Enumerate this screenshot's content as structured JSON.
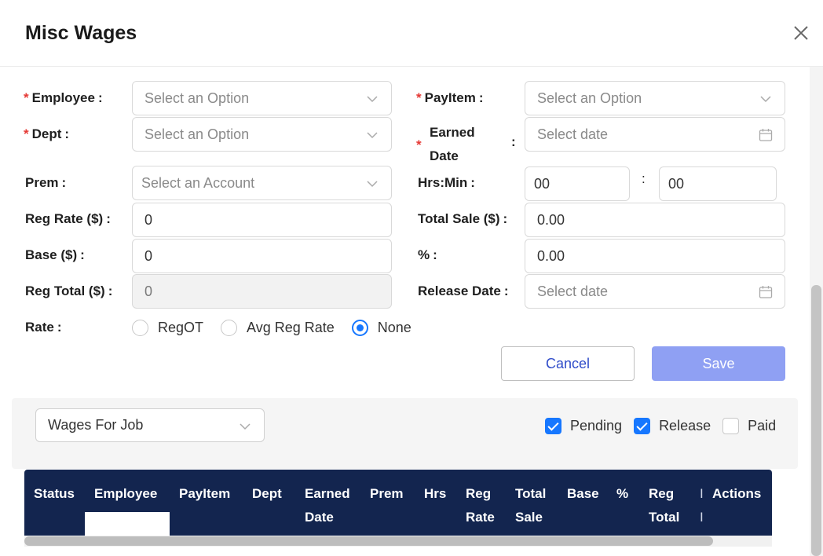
{
  "dialog": {
    "title": "Misc Wages"
  },
  "form": {
    "employee": {
      "label": "Employee",
      "required": true,
      "placeholder": "Select an Option"
    },
    "payitem": {
      "label": "PayItem",
      "required": true,
      "placeholder": "Select an Option"
    },
    "dept": {
      "label": "Dept",
      "required": true,
      "placeholder": "Select an Option"
    },
    "earned_date": {
      "label_line1": "Earned",
      "label_line2": "Date",
      "required": true,
      "placeholder": "Select date"
    },
    "prem": {
      "label": "Prem",
      "placeholder": "Select an Account"
    },
    "hrs_min": {
      "label": "Hrs:Min",
      "hours": "00",
      "separator": ":",
      "minutes": "00"
    },
    "reg_rate": {
      "label": "Reg Rate ($)",
      "value": "0"
    },
    "total_sale": {
      "label": "Total Sale ($)",
      "value": "0.00"
    },
    "base": {
      "label": "Base ($)",
      "value": "0"
    },
    "percent": {
      "label": "%",
      "value": "0.00"
    },
    "reg_total": {
      "label": "Reg Total ($)",
      "value": "0"
    },
    "release_date": {
      "label": "Release Date",
      "placeholder": "Select date"
    },
    "rate": {
      "label": "Rate",
      "options": [
        "RegOT",
        "Avg Reg Rate",
        "None"
      ],
      "selected": "None"
    },
    "colon": ":",
    "required_mark": "*",
    "buttons": {
      "cancel": "Cancel",
      "save": "Save"
    }
  },
  "filters": {
    "wages_select": "Wages For Job",
    "checkboxes": [
      {
        "label": "Pending",
        "checked": true
      },
      {
        "label": "Release",
        "checked": true
      },
      {
        "label": "Paid",
        "checked": false
      }
    ]
  },
  "table": {
    "columns": [
      {
        "line1": "Status",
        "line2": ""
      },
      {
        "line1": "Employee",
        "line2": ""
      },
      {
        "line1": "PayItem",
        "line2": ""
      },
      {
        "line1": "Dept",
        "line2": ""
      },
      {
        "line1": "Earned",
        "line2": "Date"
      },
      {
        "line1": "Prem",
        "line2": ""
      },
      {
        "line1": "Hrs",
        "line2": ""
      },
      {
        "line1": "Reg",
        "line2": "Rate"
      },
      {
        "line1": "Total",
        "line2": "Sale"
      },
      {
        "line1": "Base",
        "line2": ""
      },
      {
        "line1": "%",
        "line2": ""
      },
      {
        "line1": "Reg",
        "line2": "Total"
      },
      {
        "line1": "I",
        "line2": "I"
      },
      {
        "line1": "Actions",
        "line2": ""
      }
    ]
  },
  "icons": {
    "close": "close-icon",
    "dropdown": "chevron-down-icon",
    "calendar": "calendar-icon"
  },
  "colors": {
    "primary": "#1677ff",
    "required": "#e53935",
    "table_header": "#13254f",
    "save_button": "#8fa0f3"
  }
}
